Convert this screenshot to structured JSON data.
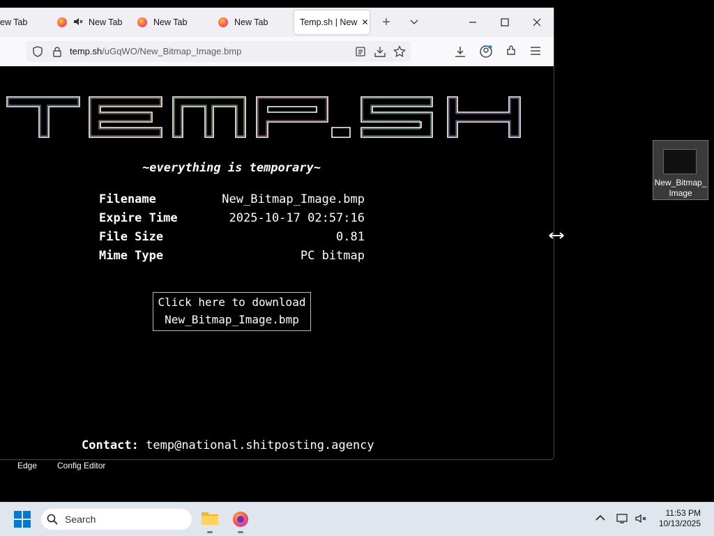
{
  "browser": {
    "tabs": [
      {
        "label": "ew Tab"
      },
      {
        "label": "New Tab"
      },
      {
        "label": "New Tab"
      },
      {
        "label": "New Tab"
      },
      {
        "label": "Temp.sh | New"
      }
    ],
    "url_host": "temp.sh",
    "url_path": "/uGqWO/New_Bitmap_Image.bmp"
  },
  "page": {
    "logo": "TEMP.SH",
    "tagline": "~everything is temporary~",
    "info": [
      {
        "label": "Filename",
        "value": "New_Bitmap_Image.bmp"
      },
      {
        "label": "Expire Time",
        "value": "2025-10-17 02:57:16"
      },
      {
        "label": "File Size",
        "value": "0.81"
      },
      {
        "label": "Mime Type",
        "value": "PC bitmap"
      }
    ],
    "download_line1": "Click here to download",
    "download_line2": "New_Bitmap_Image.bmp",
    "contact_label": "Contact:",
    "contact_email": "temp@national.shitposting.agency"
  },
  "desktop": {
    "file_icon_label": "New_Bitmap_ Image",
    "labels": [
      "Edge",
      "Config Editor"
    ]
  },
  "taskbar": {
    "search_placeholder": "Search",
    "time": "11:53 PM",
    "date": "10/13/2025"
  },
  "colors": {
    "accent": "#0067c0",
    "page_bg": "#000000",
    "tabbar_bg": "#f0f0f4"
  }
}
